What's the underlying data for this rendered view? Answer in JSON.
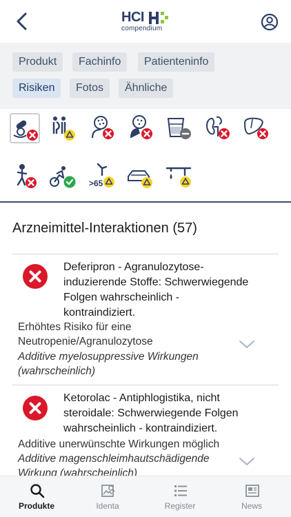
{
  "header": {
    "logo_title": "HCI",
    "logo_subtitle": "compendium",
    "back_icon": "chevron-left-icon",
    "profile_icon": "user-circle-icon"
  },
  "tabs": [
    {
      "label": "Produkt",
      "active": false
    },
    {
      "label": "Fachinfo",
      "active": false
    },
    {
      "label": "Patienteninfo",
      "active": false
    },
    {
      "label": "Risiken",
      "active": true
    },
    {
      "label": "Fotos",
      "active": false
    },
    {
      "label": "Ähnliche",
      "active": false
    }
  ],
  "risk_icons": [
    {
      "name": "interaction-icon",
      "status": "red",
      "selected": true
    },
    {
      "name": "pregnancy-icon",
      "status": "yellow"
    },
    {
      "name": "allergy-icon",
      "status": "red"
    },
    {
      "name": "contraindication-icon",
      "status": "red"
    },
    {
      "name": "alcohol-icon",
      "status": "gray"
    },
    {
      "name": "kidney-icon",
      "status": "red"
    },
    {
      "name": "liver-icon",
      "status": "red"
    },
    {
      "name": "child-icon",
      "status": "red"
    },
    {
      "name": "sport-icon",
      "status": "green"
    },
    {
      "name": "elderly-65-icon",
      "status": "yellow",
      "label": ">65"
    },
    {
      "name": "driving-icon",
      "status": "yellow"
    },
    {
      "name": "machine-icon",
      "status": "yellow"
    }
  ],
  "section": {
    "title": "Arzneimittel-Interaktionen (57)"
  },
  "interactions": [
    {
      "title_lines": [
        "Deferipron - Agranulozytose-",
        "induzierende Stoffe: Schwerwiegende",
        "Folgen wahrscheinlich -",
        "kontraindiziert."
      ],
      "desc_lines": [
        "Erhöhtes Risiko für eine",
        "Neutropenie/Agranulozytose"
      ],
      "mech_lines": [
        "Additive myelosuppressive Wirkungen",
        "(wahrscheinlich)"
      ]
    },
    {
      "title_lines": [
        "Ketorolac - Antiphlogistika, nicht",
        "steroidale: Schwerwiegende Folgen",
        "wahrscheinlich - kontraindiziert."
      ],
      "desc_lines": [
        "Additive unerwünschte Wirkungen möglich"
      ],
      "mech_lines": [
        "Additive magenschleimhautschädigende",
        "Wirkung (wahrscheinlich)"
      ]
    }
  ],
  "colors": {
    "red": "#d9182a",
    "yellow": "#f6d32c",
    "green": "#27a84a",
    "gray": "#6b6e73",
    "navy": "#2c3e66",
    "logo_green": "#8dc63f"
  },
  "bottom_nav": [
    {
      "label": "Produkte",
      "icon": "search-icon",
      "active": true
    },
    {
      "label": "Identa",
      "icon": "image-search-icon",
      "active": false
    },
    {
      "label": "Register",
      "icon": "list-icon",
      "active": false
    },
    {
      "label": "News",
      "icon": "newspaper-icon",
      "active": false
    }
  ]
}
